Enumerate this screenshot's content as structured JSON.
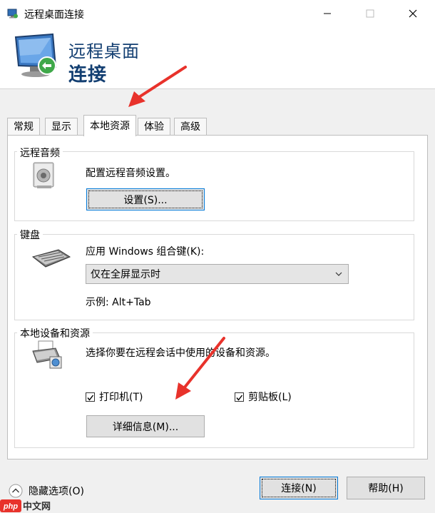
{
  "window": {
    "title": "远程桌面连接"
  },
  "banner": {
    "line1": "远程桌面",
    "line2": "连接"
  },
  "tabs": [
    {
      "label": "常规"
    },
    {
      "label": "显示"
    },
    {
      "label": "本地资源"
    },
    {
      "label": "体验"
    },
    {
      "label": "高级"
    }
  ],
  "remote_audio": {
    "title": "远程音频",
    "description": "配置远程音频设置。",
    "settings_button": "设置(S)..."
  },
  "keyboard": {
    "title": "键盘",
    "apply_label": "应用 Windows 组合键(K):",
    "selected_option": "仅在全屏显示时",
    "example": "示例: Alt+Tab"
  },
  "local_devices": {
    "title": "本地设备和资源",
    "description": "选择你要在远程会话中使用的设备和资源。",
    "printers_label": "打印机(T)",
    "clipboard_label": "剪贴板(L)",
    "more_button": "详细信息(M)..."
  },
  "footer": {
    "hide_options": "隐藏选项(O)",
    "connect_button": "连接(N)",
    "help_button": "帮助(H)"
  },
  "watermark": "中文网",
  "colors": {
    "accent": "#0078d7",
    "banner_text": "#123e71",
    "arrow": "#e8322b"
  }
}
